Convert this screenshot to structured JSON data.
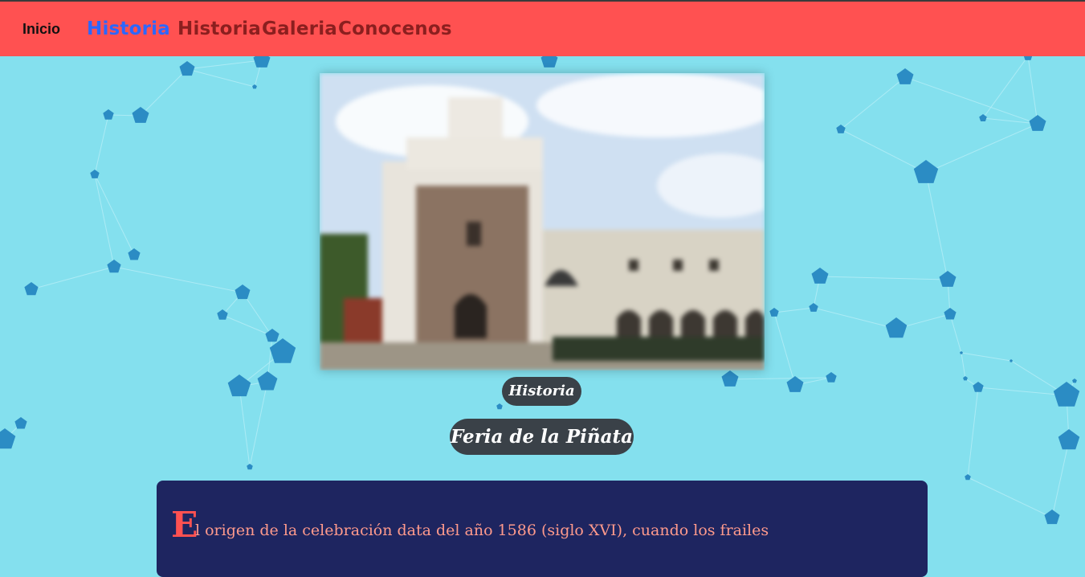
{
  "nav": {
    "brand": "Inicio",
    "links": [
      {
        "label": "Historia",
        "active": true
      },
      {
        "label": "Historia",
        "active": false
      },
      {
        "label": "Galeria",
        "active": false
      },
      {
        "label": "Conocenos",
        "active": false
      }
    ]
  },
  "hero": {
    "tag": "Historia",
    "title": "Feria de la Piñata"
  },
  "article": {
    "dropcap": "E",
    "text": "l origen de la celebración data del año 1586 (siglo XVI), cuando los frailes"
  },
  "colors": {
    "navbar": "#ff5151",
    "active_link": "#2d67ff",
    "inactive_link": "#8b1f1f",
    "background": "#84e0ee",
    "content_box": "#1e2560",
    "pill": "#3a4148",
    "text_accent": "#ff9a8c",
    "network_nodes": "#2b8cc4"
  },
  "icons": {
    "background": "network-polygons-pattern",
    "photo": "church-convent-photo"
  }
}
